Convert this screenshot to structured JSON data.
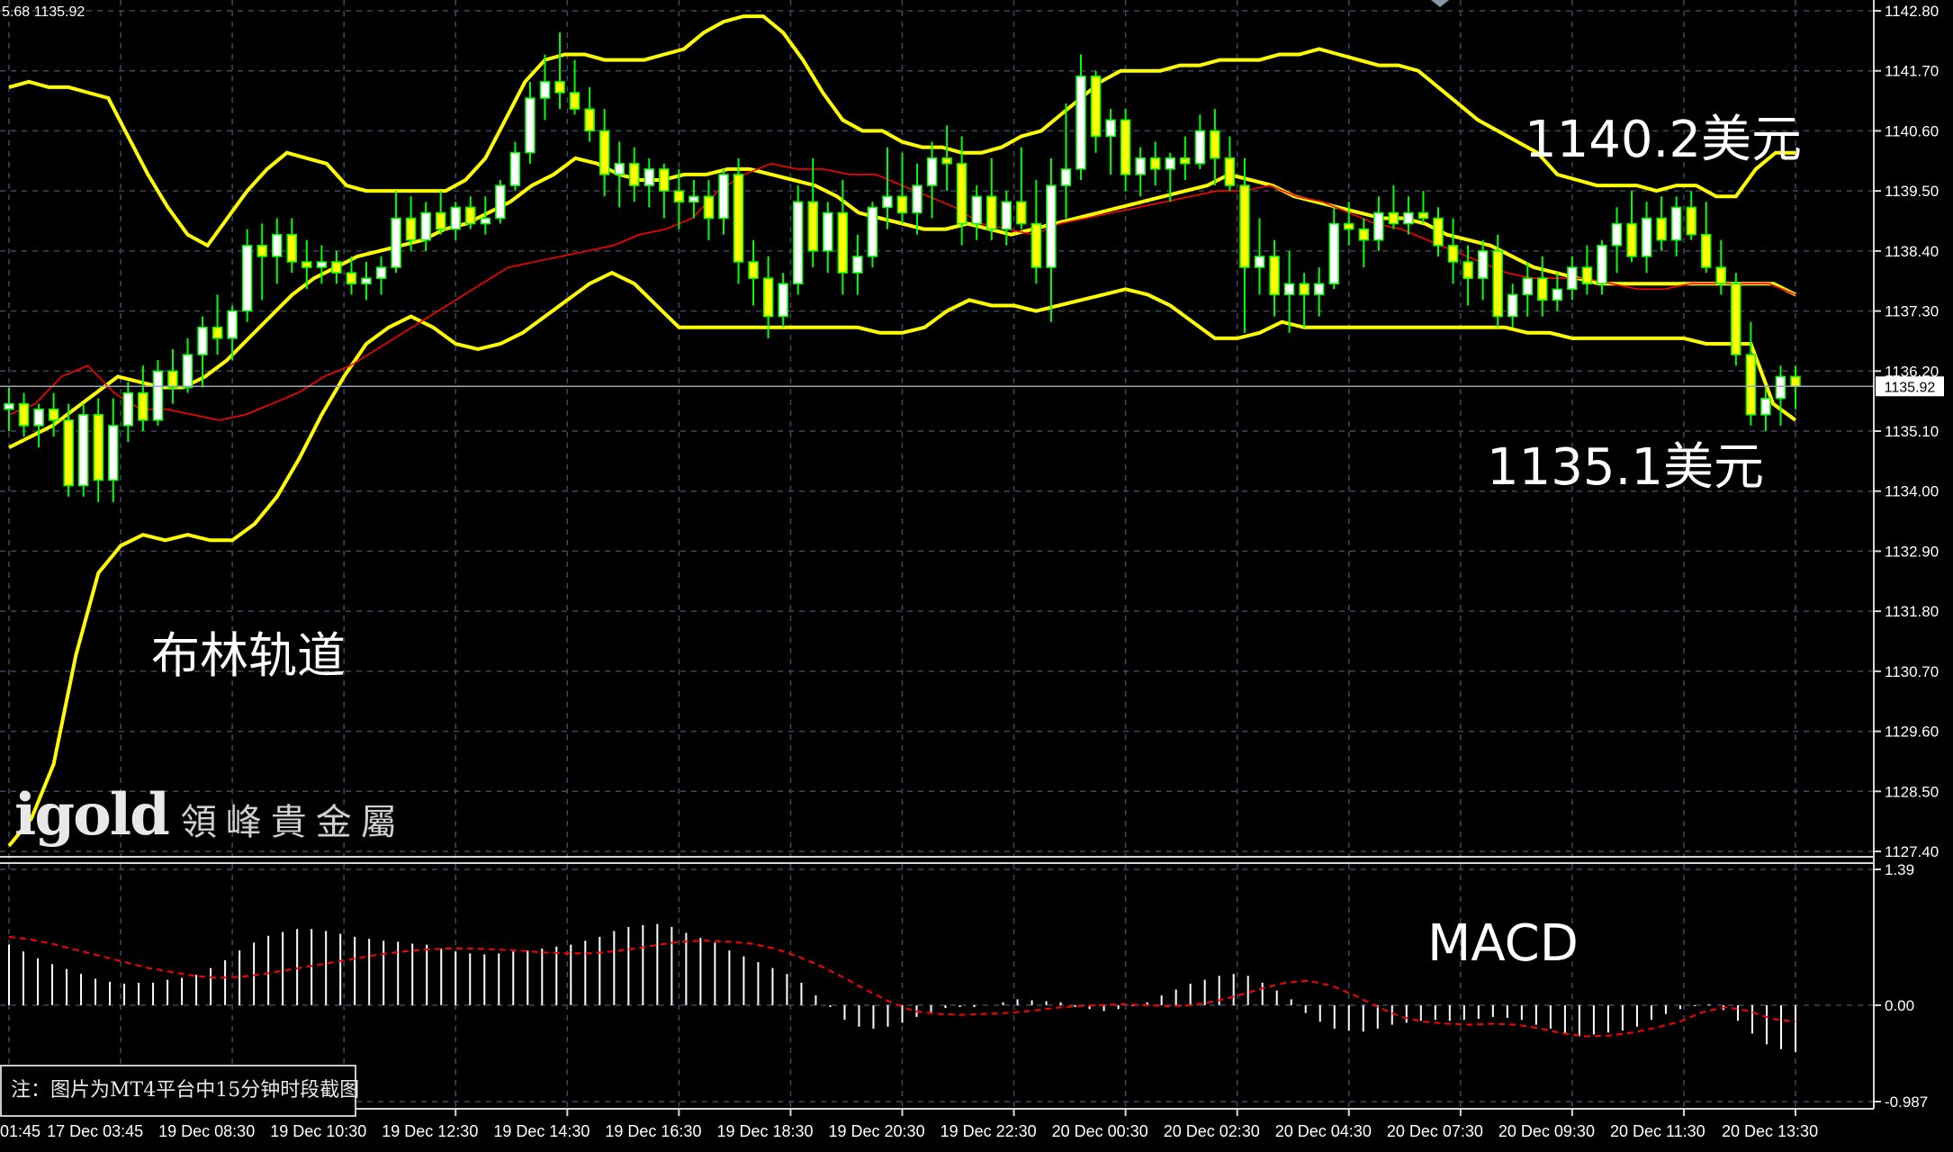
{
  "header": {
    "readout": "5.68 1135.92"
  },
  "price_axis": {
    "ticks": [
      "1142.80",
      "1141.70",
      "1140.60",
      "1139.50",
      "1138.40",
      "1137.30",
      "1136.20",
      "1135.10",
      "1134.00",
      "1132.90",
      "1131.80",
      "1130.70",
      "1129.60",
      "1128.50",
      "1127.40"
    ],
    "current_price_label": "1135.92"
  },
  "macd_axis": {
    "ticks": [
      "1.39",
      "0.00",
      "-0.987"
    ]
  },
  "time_axis": {
    "labels": [
      "01:45",
      "17 Dec 03:45",
      "19 Dec 08:30",
      "19 Dec 10:30",
      "19 Dec 12:30",
      "19 Dec 14:30",
      "19 Dec 16:30",
      "19 Dec 18:30",
      "19 Dec 20:30",
      "19 Dec 22:30",
      "20 Dec 00:30",
      "20 Dec 02:30",
      "20 Dec 04:30",
      "20 Dec 07:30",
      "20 Dec 09:30",
      "20 Dec 11:30",
      "20 Dec 13:30"
    ]
  },
  "annotations": {
    "upper_band_value": "1140.2美元",
    "lower_band_value": "1135.1美元",
    "bollinger_label": "布林轨道",
    "macd_label": "MACD"
  },
  "logo": {
    "main": "igold",
    "sub": "領峰貴金屬"
  },
  "footnote": "注：图片为MT4平台中15分钟时段截图",
  "colors": {
    "bollinger": "#ffff00",
    "ma": "#ff0000",
    "candle_up": "#ffffff",
    "candle_down": "#ffff00",
    "wick": "#00ff00",
    "macd_hist": "#ffffff",
    "signal": "#ff0000",
    "grid": "#3a4a5a"
  },
  "chart_data": {
    "type": "candlestick",
    "timeframe": "M15",
    "ylim": [
      1127.4,
      1142.8
    ],
    "macd_ylim": [
      -0.987,
      1.39
    ],
    "upper_band": [
      1141.4,
      1141.5,
      1141.4,
      1141.4,
      1141.3,
      1141.2,
      1140.5,
      1139.8,
      1139.2,
      1138.7,
      1138.5,
      1139.0,
      1139.5,
      1139.9,
      1140.2,
      1140.1,
      1140.0,
      1139.6,
      1139.5,
      1139.5,
      1139.5,
      1139.5,
      1139.5,
      1139.7,
      1140.1,
      1140.8,
      1141.5,
      1141.9,
      1142.0,
      1142.0,
      1141.9,
      1141.9,
      1141.9,
      1142.0,
      1142.1,
      1142.4,
      1142.6,
      1142.7,
      1142.7,
      1142.4,
      1141.9,
      1141.3,
      1140.8,
      1140.6,
      1140.6,
      1140.4,
      1140.3,
      1140.3,
      1140.2,
      1140.2,
      1140.3,
      1140.5,
      1140.6,
      1140.9,
      1141.2,
      1141.5,
      1141.7,
      1141.7,
      1141.7,
      1141.8,
      1141.8,
      1141.9,
      1141.9,
      1141.9,
      1142.0,
      1142.0,
      1142.1,
      1142.0,
      1141.9,
      1141.8,
      1141.8,
      1141.7,
      1141.4,
      1141.1,
      1140.8,
      1140.6,
      1140.4,
      1140.2,
      1139.8,
      1139.7,
      1139.6,
      1139.6,
      1139.6,
      1139.5,
      1139.6,
      1139.6,
      1139.4,
      1139.4,
      1139.9,
      1140.2,
      1140.2
    ],
    "middle_band": [
      1134.8,
      1135.0,
      1135.2,
      1135.5,
      1135.8,
      1136.1,
      1136.0,
      1135.9,
      1135.9,
      1136.1,
      1136.4,
      1136.8,
      1137.2,
      1137.6,
      1137.9,
      1138.1,
      1138.3,
      1138.4,
      1138.5,
      1138.6,
      1138.8,
      1138.9,
      1139.1,
      1139.3,
      1139.6,
      1139.8,
      1140.1,
      1140.0,
      1139.8,
      1139.7,
      1139.7,
      1139.8,
      1139.8,
      1139.9,
      1139.9,
      1139.8,
      1139.7,
      1139.6,
      1139.4,
      1139.1,
      1139.0,
      1138.9,
      1138.8,
      1138.8,
      1138.9,
      1138.8,
      1138.7,
      1138.8,
      1138.9,
      1139.0,
      1139.1,
      1139.2,
      1139.3,
      1139.4,
      1139.5,
      1139.6,
      1139.8,
      1139.7,
      1139.6,
      1139.4,
      1139.3,
      1139.2,
      1139.1,
      1139.0,
      1139.0,
      1138.9,
      1138.7,
      1138.6,
      1138.5,
      1138.3,
      1138.1,
      1138.0,
      1137.9,
      1137.8,
      1137.8,
      1137.8,
      1137.8,
      1137.8,
      1137.8,
      1137.8,
      1137.8,
      1137.8,
      1137.6
    ],
    "lower_band": [
      1127.5,
      1128.0,
      1129.0,
      1131.0,
      1132.5,
      1133.0,
      1133.2,
      1133.1,
      1133.2,
      1133.1,
      1133.1,
      1133.4,
      1133.9,
      1134.6,
      1135.4,
      1136.1,
      1136.7,
      1137.0,
      1137.2,
      1137.0,
      1136.7,
      1136.6,
      1136.7,
      1136.9,
      1137.2,
      1137.5,
      1137.8,
      1138.0,
      1137.8,
      1137.4,
      1137.0,
      1137.0,
      1137.0,
      1137.0,
      1137.0,
      1137.0,
      1137.0,
      1137.0,
      1137.0,
      1136.9,
      1136.9,
      1137.0,
      1137.3,
      1137.5,
      1137.4,
      1137.4,
      1137.3,
      1137.4,
      1137.5,
      1137.6,
      1137.7,
      1137.6,
      1137.4,
      1137.1,
      1136.8,
      1136.8,
      1136.9,
      1137.1,
      1137.0,
      1137.0,
      1137.0,
      1137.0,
      1137.0,
      1137.0,
      1137.0,
      1137.0,
      1137.0,
      1137.0,
      1136.9,
      1136.9,
      1136.8,
      1136.8,
      1136.8,
      1136.8,
      1136.8,
      1136.8,
      1136.7,
      1136.7,
      1136.7,
      1135.6,
      1135.3
    ],
    "moving_average": [
      1135.4,
      1135.6,
      1136.1,
      1136.3,
      1135.8,
      1135.5,
      1135.5,
      1135.4,
      1135.3,
      1135.4,
      1135.6,
      1135.8,
      1136.1,
      1136.3,
      1136.6,
      1136.9,
      1137.2,
      1137.5,
      1137.8,
      1138.1,
      1138.2,
      1138.3,
      1138.4,
      1138.5,
      1138.7,
      1138.8,
      1139.0,
      1139.5,
      1139.8,
      1140.0,
      1139.9,
      1139.9,
      1139.8,
      1139.8,
      1139.6,
      1139.4,
      1139.2,
      1138.9,
      1138.8,
      1138.7,
      1138.9,
      1139.0,
      1139.1,
      1139.2,
      1139.3,
      1139.4,
      1139.5,
      1139.5,
      1139.6,
      1139.4,
      1139.3,
      1139.1,
      1138.9,
      1138.8,
      1138.6,
      1138.4,
      1138.2,
      1138.0,
      1137.9,
      1137.9,
      1137.9,
      1137.8,
      1137.7,
      1137.7,
      1137.8,
      1137.8,
      1137.8,
      1137.8,
      1137.6
    ],
    "candles": [
      [
        1135.5,
        1135.9,
        1135.1,
        1135.6
      ],
      [
        1135.6,
        1135.8,
        1135.0,
        1135.2
      ],
      [
        1135.2,
        1135.6,
        1134.8,
        1135.5
      ],
      [
        1135.5,
        1135.8,
        1135.0,
        1135.3
      ],
      [
        1135.3,
        1135.6,
        1133.9,
        1134.1
      ],
      [
        1134.1,
        1135.6,
        1133.9,
        1135.4
      ],
      [
        1135.4,
        1135.7,
        1133.8,
        1134.2
      ],
      [
        1134.2,
        1135.7,
        1133.8,
        1135.2
      ],
      [
        1135.2,
        1136.0,
        1134.9,
        1135.8
      ],
      [
        1135.8,
        1136.3,
        1135.1,
        1135.3
      ],
      [
        1135.3,
        1136.4,
        1135.2,
        1136.2
      ],
      [
        1136.2,
        1136.6,
        1135.6,
        1135.9
      ],
      [
        1135.9,
        1136.8,
        1135.8,
        1136.5
      ],
      [
        1136.5,
        1137.2,
        1135.9,
        1137.0
      ],
      [
        1137.0,
        1137.6,
        1136.5,
        1136.8
      ],
      [
        1136.8,
        1137.4,
        1136.4,
        1137.3
      ],
      [
        1137.3,
        1138.8,
        1137.1,
        1138.5
      ],
      [
        1138.5,
        1138.9,
        1137.5,
        1138.3
      ],
      [
        1138.3,
        1139.0,
        1137.8,
        1138.7
      ],
      [
        1138.7,
        1139.0,
        1138.0,
        1138.2
      ],
      [
        1138.2,
        1138.6,
        1137.7,
        1138.1
      ],
      [
        1138.1,
        1138.5,
        1137.8,
        1138.2
      ],
      [
        1138.2,
        1138.4,
        1137.8,
        1138.0
      ],
      [
        1138.0,
        1138.3,
        1137.6,
        1137.8
      ],
      [
        1137.8,
        1138.2,
        1137.5,
        1137.9
      ],
      [
        1137.9,
        1138.3,
        1137.6,
        1138.1
      ],
      [
        1138.1,
        1139.5,
        1138.0,
        1139.0
      ],
      [
        1139.0,
        1139.4,
        1138.4,
        1138.6
      ],
      [
        1138.6,
        1139.3,
        1138.4,
        1139.1
      ],
      [
        1139.1,
        1139.5,
        1138.7,
        1138.8
      ],
      [
        1138.8,
        1139.3,
        1138.6,
        1139.2
      ],
      [
        1139.2,
        1139.4,
        1138.8,
        1138.9
      ],
      [
        1138.9,
        1139.4,
        1138.7,
        1139.0
      ],
      [
        1139.0,
        1139.7,
        1138.9,
        1139.6
      ],
      [
        1139.6,
        1140.4,
        1139.5,
        1140.2
      ],
      [
        1140.2,
        1141.5,
        1140.0,
        1141.2
      ],
      [
        1141.2,
        1142.0,
        1140.8,
        1141.5
      ],
      [
        1141.5,
        1142.4,
        1141.0,
        1141.3
      ],
      [
        1141.3,
        1141.9,
        1140.9,
        1141.0
      ],
      [
        1141.0,
        1141.4,
        1140.4,
        1140.6
      ],
      [
        1140.6,
        1141.0,
        1139.4,
        1139.8
      ],
      [
        1139.8,
        1140.4,
        1139.2,
        1140.0
      ],
      [
        1140.0,
        1140.3,
        1139.3,
        1139.6
      ],
      [
        1139.6,
        1140.1,
        1139.2,
        1139.9
      ],
      [
        1139.9,
        1140.0,
        1139.0,
        1139.5
      ],
      [
        1139.5,
        1139.9,
        1138.8,
        1139.3
      ],
      [
        1139.3,
        1139.7,
        1139.0,
        1139.4
      ],
      [
        1139.4,
        1139.7,
        1138.6,
        1139.0
      ],
      [
        1139.0,
        1139.9,
        1138.7,
        1139.8
      ],
      [
        1139.8,
        1140.1,
        1137.8,
        1138.2
      ],
      [
        1138.2,
        1138.6,
        1137.4,
        1137.9
      ],
      [
        1137.9,
        1138.3,
        1136.8,
        1137.2
      ],
      [
        1137.2,
        1138.0,
        1137.0,
        1137.8
      ],
      [
        1137.8,
        1139.6,
        1137.6,
        1139.3
      ],
      [
        1139.3,
        1140.1,
        1138.1,
        1138.4
      ],
      [
        1138.4,
        1139.3,
        1138.0,
        1139.1
      ],
      [
        1139.1,
        1139.7,
        1137.6,
        1138.0
      ],
      [
        1138.0,
        1138.7,
        1137.6,
        1138.3
      ],
      [
        1138.3,
        1139.3,
        1138.1,
        1139.2
      ],
      [
        1139.2,
        1140.3,
        1138.8,
        1139.4
      ],
      [
        1139.4,
        1140.2,
        1138.9,
        1139.1
      ],
      [
        1139.1,
        1140.0,
        1138.7,
        1139.6
      ],
      [
        1139.6,
        1140.4,
        1139.0,
        1140.1
      ],
      [
        1140.1,
        1140.7,
        1139.5,
        1140.0
      ],
      [
        1140.0,
        1140.5,
        1138.5,
        1138.9
      ],
      [
        1138.9,
        1139.6,
        1138.6,
        1139.4
      ],
      [
        1139.4,
        1140.1,
        1138.6,
        1138.8
      ],
      [
        1138.8,
        1139.5,
        1138.5,
        1139.3
      ],
      [
        1139.3,
        1140.3,
        1138.8,
        1138.9
      ],
      [
        1138.9,
        1139.7,
        1137.8,
        1138.1
      ],
      [
        1138.1,
        1140.1,
        1137.1,
        1139.6
      ],
      [
        1139.6,
        1141.1,
        1139.0,
        1139.9
      ],
      [
        1139.9,
        1142.0,
        1139.7,
        1141.6
      ],
      [
        1141.6,
        1141.7,
        1140.2,
        1140.5
      ],
      [
        1140.5,
        1141.0,
        1139.8,
        1140.8
      ],
      [
        1140.8,
        1141.0,
        1139.5,
        1139.8
      ],
      [
        1139.8,
        1140.3,
        1139.4,
        1140.1
      ],
      [
        1140.1,
        1140.4,
        1139.6,
        1139.9
      ],
      [
        1139.9,
        1140.2,
        1139.3,
        1140.1
      ],
      [
        1140.1,
        1140.5,
        1139.7,
        1140.0
      ],
      [
        1140.0,
        1140.9,
        1139.9,
        1140.6
      ],
      [
        1140.6,
        1141.0,
        1139.6,
        1140.1
      ],
      [
        1140.1,
        1140.5,
        1139.5,
        1139.6
      ],
      [
        1139.6,
        1140.1,
        1136.9,
        1138.1
      ],
      [
        1138.1,
        1139.0,
        1137.6,
        1138.3
      ],
      [
        1138.3,
        1138.6,
        1137.2,
        1137.6
      ],
      [
        1137.6,
        1138.4,
        1136.9,
        1137.8
      ],
      [
        1137.8,
        1138.0,
        1137.0,
        1137.6
      ],
      [
        1137.6,
        1138.1,
        1137.2,
        1137.8
      ],
      [
        1137.8,
        1139.2,
        1137.7,
        1138.9
      ],
      [
        1138.9,
        1139.3,
        1138.5,
        1138.8
      ],
      [
        1138.8,
        1139.0,
        1138.1,
        1138.6
      ],
      [
        1138.6,
        1139.4,
        1138.4,
        1139.1
      ],
      [
        1139.1,
        1139.6,
        1138.8,
        1138.9
      ],
      [
        1138.9,
        1139.4,
        1138.7,
        1139.1
      ],
      [
        1139.1,
        1139.5,
        1138.9,
        1139.0
      ],
      [
        1139.0,
        1139.2,
        1138.3,
        1138.5
      ],
      [
        1138.5,
        1139.0,
        1137.8,
        1138.2
      ],
      [
        1138.2,
        1138.5,
        1137.4,
        1137.9
      ],
      [
        1137.9,
        1138.6,
        1137.5,
        1138.4
      ],
      [
        1138.4,
        1138.7,
        1137.0,
        1137.2
      ],
      [
        1137.2,
        1137.8,
        1137.0,
        1137.6
      ],
      [
        1137.6,
        1138.2,
        1137.2,
        1137.9
      ],
      [
        1137.9,
        1138.3,
        1137.2,
        1137.5
      ],
      [
        1137.5,
        1138.0,
        1137.3,
        1137.7
      ],
      [
        1137.7,
        1138.3,
        1137.5,
        1138.1
      ],
      [
        1138.1,
        1138.5,
        1137.6,
        1137.8
      ],
      [
        1137.8,
        1138.6,
        1137.6,
        1138.5
      ],
      [
        1138.5,
        1139.2,
        1138.0,
        1138.9
      ],
      [
        1138.9,
        1139.5,
        1138.2,
        1138.3
      ],
      [
        1138.3,
        1139.3,
        1138.0,
        1139.0
      ],
      [
        1139.0,
        1139.4,
        1138.4,
        1138.6
      ],
      [
        1138.6,
        1139.4,
        1138.3,
        1139.2
      ],
      [
        1139.2,
        1139.5,
        1138.6,
        1138.7
      ],
      [
        1138.7,
        1139.3,
        1138.0,
        1138.1
      ],
      [
        1138.1,
        1138.6,
        1137.6,
        1137.8
      ],
      [
        1137.8,
        1138.0,
        1136.3,
        1136.5
      ],
      [
        1136.5,
        1137.1,
        1135.2,
        1135.4
      ],
      [
        1135.4,
        1135.9,
        1135.1,
        1135.7
      ],
      [
        1135.7,
        1136.3,
        1135.2,
        1136.1
      ],
      [
        1136.1,
        1136.3,
        1135.5,
        1135.92
      ]
    ],
    "macd_histogram": [
      0.62,
      0.55,
      0.48,
      0.42,
      0.37,
      0.32,
      0.27,
      0.24,
      0.22,
      0.23,
      0.23,
      0.26,
      0.28,
      0.31,
      0.38,
      0.46,
      0.56,
      0.64,
      0.71,
      0.75,
      0.78,
      0.78,
      0.76,
      0.73,
      0.7,
      0.68,
      0.66,
      0.65,
      0.63,
      0.62,
      0.58,
      0.55,
      0.53,
      0.52,
      0.53,
      0.55,
      0.56,
      0.58,
      0.6,
      0.62,
      0.66,
      0.7,
      0.76,
      0.8,
      0.82,
      0.83,
      0.8,
      0.74,
      0.69,
      0.64,
      0.56,
      0.5,
      0.44,
      0.38,
      0.32,
      0.23,
      0.1,
      -0.02,
      -0.15,
      -0.22,
      -0.24,
      -0.22,
      -0.18,
      -0.12,
      -0.07,
      -0.03,
      -0.02,
      -0.02,
      0.0,
      0.03,
      0.06,
      0.05,
      0.04,
      0.03,
      -0.02,
      -0.04,
      -0.06,
      -0.04,
      -0.01,
      0.03,
      0.1,
      0.16,
      0.22,
      0.26,
      0.3,
      0.32,
      0.3,
      0.23,
      0.15,
      0.06,
      -0.08,
      -0.17,
      -0.24,
      -0.26,
      -0.27,
      -0.24,
      -0.2,
      -0.18,
      -0.16,
      -0.15,
      -0.16,
      -0.15,
      -0.14,
      -0.12,
      -0.13,
      -0.15,
      -0.2,
      -0.24,
      -0.3,
      -0.32,
      -0.3,
      -0.28,
      -0.26,
      -0.22,
      -0.15,
      -0.09,
      -0.04,
      -0.01,
      0.01,
      -0.05,
      -0.16,
      -0.29,
      -0.4,
      -0.45,
      -0.48
    ],
    "macd_signal": [
      0.7,
      0.67,
      0.62,
      0.56,
      0.5,
      0.44,
      0.38,
      0.34,
      0.3,
      0.28,
      0.29,
      0.32,
      0.36,
      0.4,
      0.44,
      0.48,
      0.52,
      0.55,
      0.57,
      0.58,
      0.58,
      0.57,
      0.56,
      0.54,
      0.53,
      0.53,
      0.55,
      0.58,
      0.62,
      0.65,
      0.66,
      0.65,
      0.63,
      0.58,
      0.5,
      0.4,
      0.28,
      0.15,
      0.03,
      -0.06,
      -0.09,
      -0.1,
      -0.09,
      -0.08,
      -0.06,
      -0.03,
      -0.01,
      0.0,
      0.01,
      0.0,
      -0.01,
      0.0,
      0.04,
      0.1,
      0.17,
      0.23,
      0.25,
      0.2,
      0.1,
      -0.02,
      -0.12,
      -0.17,
      -0.19,
      -0.2,
      -0.19,
      -0.2,
      -0.24,
      -0.29,
      -0.32,
      -0.31,
      -0.28,
      -0.23,
      -0.17,
      -0.07,
      -0.02,
      -0.06,
      -0.14,
      -0.17
    ]
  }
}
